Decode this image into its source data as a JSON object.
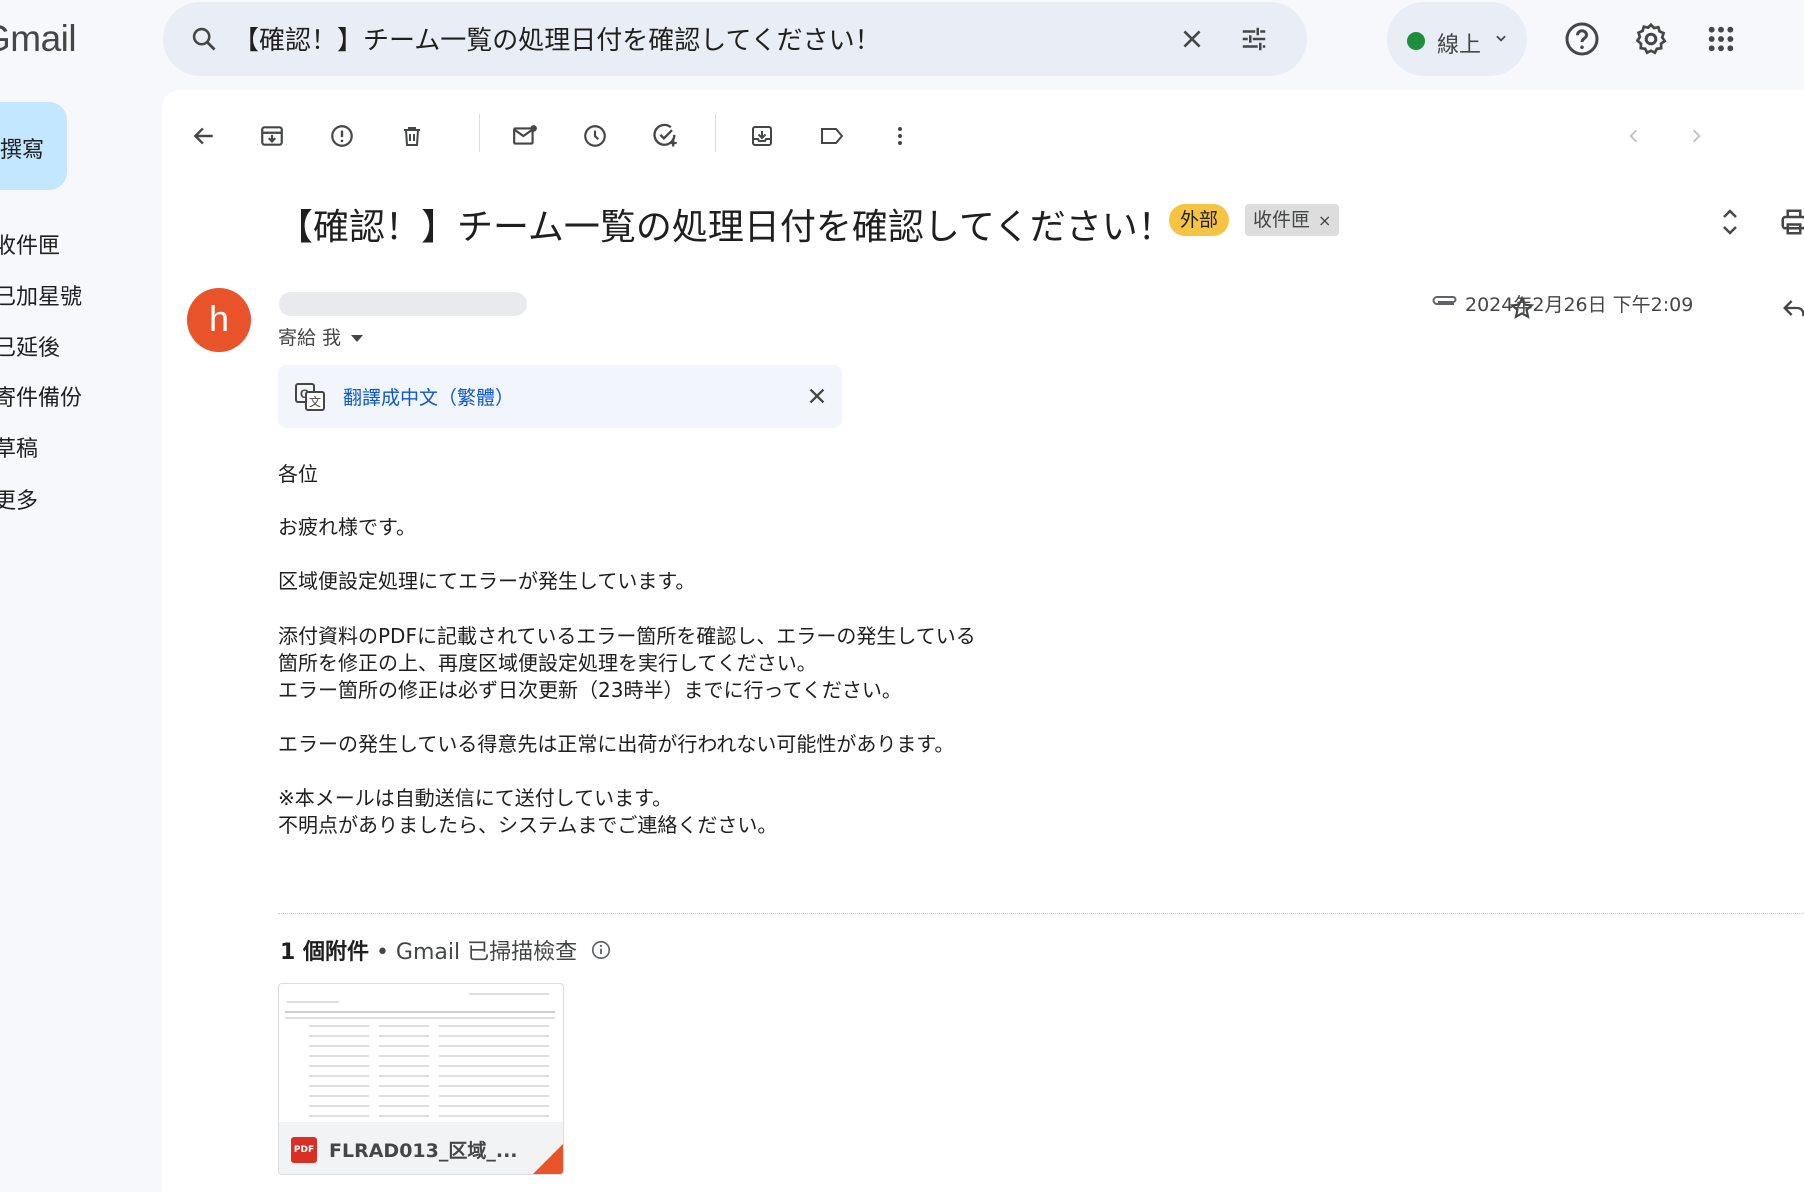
{
  "app": {
    "logo": "Gmail"
  },
  "search": {
    "query": "【確認！】チーム一覧の処理日付を確認してください！"
  },
  "status": {
    "label": "線上",
    "color": "#1e8e3e"
  },
  "sidebar": {
    "compose_label": "撰寫",
    "items": [
      {
        "label": "收件匣"
      },
      {
        "label": "已加星號"
      },
      {
        "label": "已延後"
      },
      {
        "label": "寄件備份"
      },
      {
        "label": "草稿"
      },
      {
        "label": "更多"
      }
    ]
  },
  "email": {
    "subject": "【確認！】チーム一覧の処理日付を確認してください！",
    "labels": {
      "external": "外部",
      "inbox": "收件匣",
      "inbox_remove": "×"
    },
    "avatar_letter": "h",
    "avatar_color": "#e8532a",
    "to_line": "寄給 我",
    "date": "2024年2月26日 下午2:09",
    "translate_link": "翻譯成中文（繁體）",
    "body_lines": [
      "各位",
      "お疲れ様です。",
      "区域便設定処理にてエラーが発生しています。",
      "添付資料のPDFに記載されているエラー箇所を確認し、エラーの発生している",
      "箇所を修正の上、再度区域便設定処理を実行してください。",
      "エラー箇所の修正は必ず日次更新（23時半）までに行ってください。",
      "エラーの発生している得意先は正常に出荷が行われない可能性があります。",
      "※本メールは自動送信にて送付しています。",
      "不明点がありましたら、システムまでご連絡ください。"
    ],
    "attachments": {
      "count_label": "1 個附件",
      "scan_label": " • Gmail 已掃描檢查",
      "file_name": "FLRAD013_区域_...",
      "file_type": "PDF"
    }
  }
}
